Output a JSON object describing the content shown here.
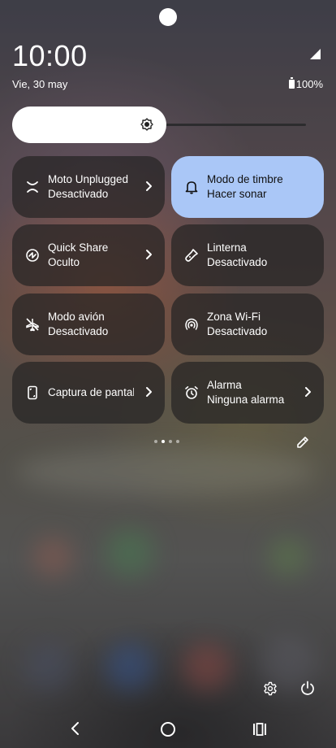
{
  "status": {
    "time": "10:00",
    "date": "Vie, 30 may",
    "battery": "100%",
    "brightness_level": 0.46
  },
  "tiles": [
    {
      "label": "Moto Unplugged",
      "state": "Desactivado",
      "icon": "moto-unplugged-icon",
      "chevron": true,
      "active": false
    },
    {
      "label": "Modo de timbre",
      "state": "Hacer sonar",
      "icon": "bell-icon",
      "chevron": false,
      "active": true
    },
    {
      "label": "Quick Share",
      "state": "Oculto",
      "icon": "quick-share-icon",
      "chevron": true,
      "active": false
    },
    {
      "label": "Linterna",
      "state": "Desactivado",
      "icon": "flashlight-icon",
      "chevron": false,
      "active": false
    },
    {
      "label": "Modo avión",
      "state": "Desactivado",
      "icon": "airplane-off-icon",
      "chevron": false,
      "active": false
    },
    {
      "label": "Zona Wi-Fi",
      "state": "Desactivado",
      "icon": "hotspot-icon",
      "chevron": false,
      "active": false
    },
    {
      "label": "Captura de pantalla",
      "state": "",
      "icon": "screenshot-icon",
      "chevron": true,
      "active": false
    },
    {
      "label": "Alarma",
      "state": "Ninguna alarma",
      "icon": "alarm-icon",
      "chevron": true,
      "active": false
    }
  ],
  "pager": {
    "pages": 4,
    "current": 1
  },
  "colors": {
    "active_tile": "#aac7f7",
    "tile": "#262424"
  }
}
